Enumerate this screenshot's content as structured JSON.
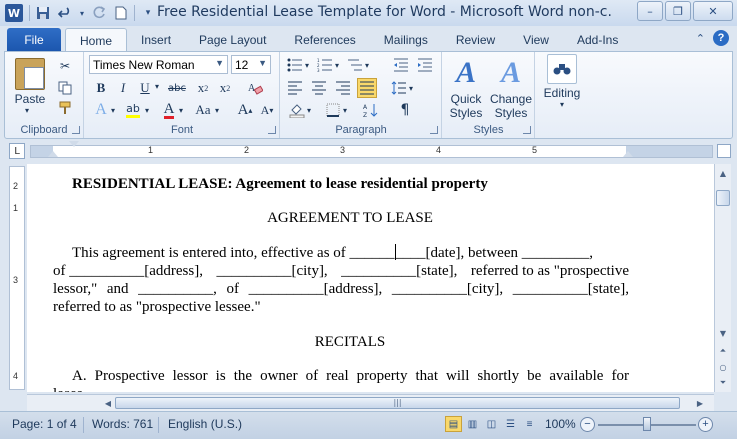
{
  "window": {
    "title": "Free Residential Lease Template for Word  -  Microsoft Word non-c...",
    "app_icon": "W"
  },
  "qat": {
    "icons": [
      "save-icon",
      "undo-icon",
      "redo-icon",
      "new-document-icon",
      "customize-qat-icon"
    ]
  },
  "tabs": [
    {
      "label": "File"
    },
    {
      "label": "Home"
    },
    {
      "label": "Insert"
    },
    {
      "label": "Page Layout"
    },
    {
      "label": "References"
    },
    {
      "label": "Mailings"
    },
    {
      "label": "Review"
    },
    {
      "label": "View"
    },
    {
      "label": "Add-Ins"
    }
  ],
  "ribbon": {
    "clipboard": {
      "label": "Clipboard",
      "paste_label": "Paste"
    },
    "font": {
      "label": "Font",
      "font_name": "Times New Roman",
      "font_size": "12"
    },
    "paragraph": {
      "label": "Paragraph"
    },
    "styles": {
      "label": "Styles",
      "quick_styles": "Quick Styles",
      "change_styles": "Change Styles"
    },
    "editing": {
      "label": "Editing"
    }
  },
  "ruler": {
    "numbers": [
      "1",
      "2",
      "3",
      "4",
      "5"
    ],
    "vertical_numbers": [
      "2",
      "1",
      "3",
      "4"
    ]
  },
  "document": {
    "heading": "RESIDENTIAL LEASE:  Agreement to lease residential property",
    "subheading": "AGREEMENT TO LEASE",
    "para1_line1_a": "This agreement is entered into, effective as of ______",
    "para1_line1_b": "____[date], between _________,",
    "para1_line2": [
      "of __________[address],",
      "__________[city],",
      "__________[state],",
      "referred to as \"prospective"
    ],
    "para1_line3": [
      "lessor,\"",
      "and",
      "__________,",
      "of",
      "__________[address],",
      "__________[city],",
      "__________[state],"
    ],
    "para1_line4": "referred to as \"prospective lessee.\"",
    "recitals": "RECITALS",
    "para2_line1": [
      "A.",
      "Prospective",
      "lessor",
      "is",
      "the",
      "owner",
      "of",
      "real",
      "property",
      "that",
      "will",
      "shortly",
      "be",
      "available",
      "for"
    ],
    "para2_line2": "lease"
  },
  "statusbar": {
    "page": "Page: 1 of 4",
    "words": "Words: 761",
    "language": "English (U.S.)",
    "zoom": "100%",
    "zoom_fraction": 0.5
  }
}
